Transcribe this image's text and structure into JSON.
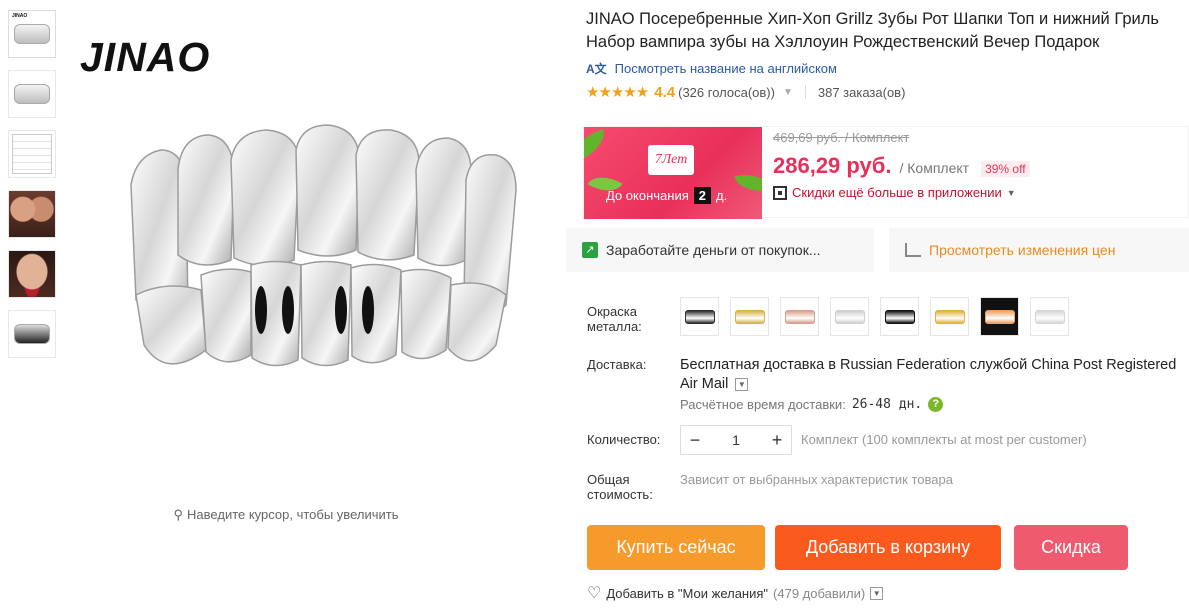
{
  "gallery": {
    "brand": "JINAO",
    "zoom_hint": "Наведите курсор, чтобы увеличить",
    "thumb_brand": "JINAO"
  },
  "product": {
    "title": "JINAO Посеребренные Хип-Хоп Grillz Зубы Рот Шапки Топ и нижний Гриль Набор вампира зубы на Хэллоуин Рождественский Вечер Подарок",
    "translate_link": "Посмотреть название на английском",
    "rating_value": "4.4",
    "votes": "(326 голоса(ов))",
    "orders": "387 заказа(ов)"
  },
  "price": {
    "promo_badge": "7Лет",
    "promo_until": "До окончания",
    "promo_days": "2",
    "promo_days_unit": "д.",
    "old": "469,69 руб. / Комплект",
    "current": "286,29 руб.",
    "unit": "/ Комплект",
    "discount": "39% off",
    "app_discount": "Скидки ещё больше в приложении"
  },
  "actions_bar": {
    "earn": "Заработайте деньги от покупок...",
    "watch": "Просмотреть изменения цен"
  },
  "options": {
    "color_label": "Окраска металла:",
    "swatch_colors": [
      "#2e2e2e",
      "#d8b34a",
      "#d9a08c",
      "#cfcfcf",
      "#111111",
      "#e2b13a",
      "#f0a060",
      "#d6d6d6"
    ],
    "shipping_label": "Доставка:",
    "shipping_text": "Бесплатная доставка в Russian Federation службой China Post Registered Air Mail",
    "eta_label": "Расчётное время доставки:",
    "eta_value": "26-48 дн.",
    "quantity_label": "Количество:",
    "quantity_value": "1",
    "quantity_note": "Комплект (100 комплекты at most per customer)",
    "total_label": "Общая стоимость:",
    "total_note": "Зависит от выбранных характеристик товара"
  },
  "buttons": {
    "buy": "Купить сейчас",
    "cart": "Добавить в корзину",
    "coupon": "Скидка"
  },
  "wishlist": {
    "label": "Добавить в \"Мои желания\"",
    "count": "(479 добавили)"
  },
  "colors": {
    "accent_price": "#e8305a",
    "buy": "#f59a2b",
    "cart": "#fb5a1f",
    "coupon": "#f05a6e",
    "link": "#2a5aa8"
  }
}
